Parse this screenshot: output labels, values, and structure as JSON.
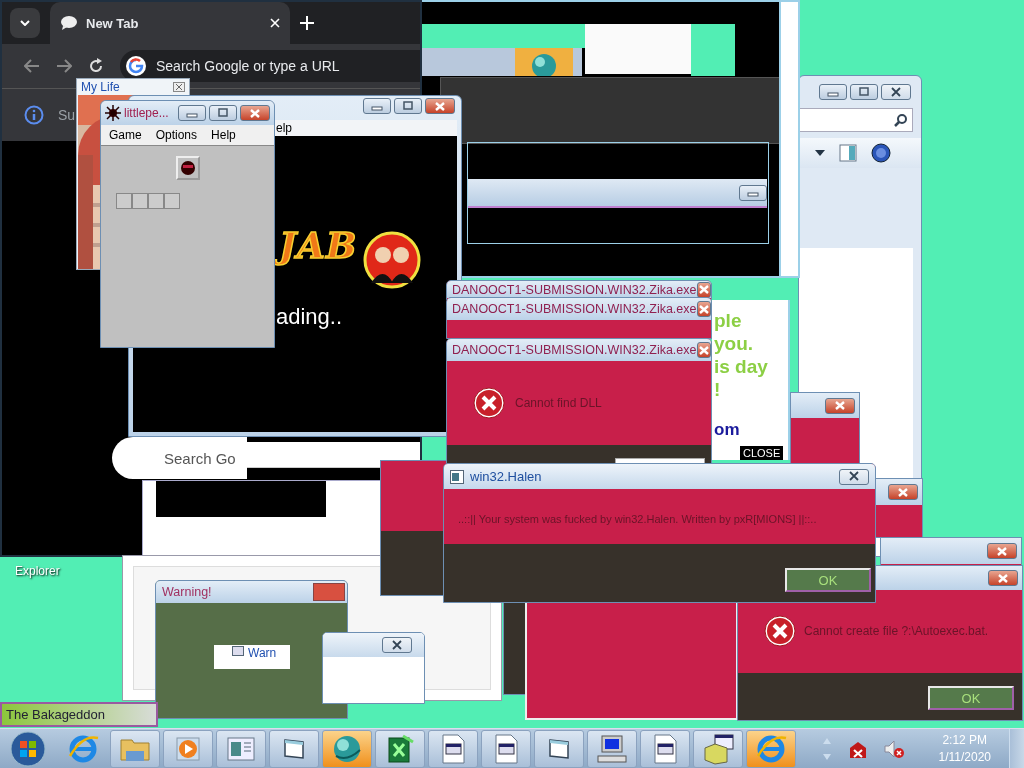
{
  "chrome_window": {
    "tab_title": "New Tab",
    "address_placeholder": "Search Google or type a URL",
    "info_text": "Su",
    "search_placeholder": "Search Go"
  },
  "my_life_window": {
    "title": "My Life"
  },
  "game_window": {
    "menu_fragment": "elp",
    "logo_text": "JAB",
    "loading_text": "ading.."
  },
  "littlepe_window": {
    "title": "littlepe...",
    "menu": [
      "Game",
      "Options",
      "Help"
    ]
  },
  "ad_popup": {
    "lines": [
      "ple",
      "you.",
      "is day",
      "!"
    ],
    "link": "om",
    "close_label": "CLOSE"
  },
  "zika_windows": [
    {
      "title": "DANOOCT1-SUBMISSION.WIN32.Zika.exe"
    },
    {
      "title": "DANOOCT1-SUBMISSION.WIN32.Zika.exe"
    },
    {
      "title": "DANOOCT1-SUBMISSION.WIN32.Zika.exe",
      "message": "Cannot find DLL"
    }
  ],
  "halen_dialog": {
    "title": "win32.Halen",
    "message": "..::|| Your system was fucked by win32.Halen. Written by pxR[MIONS] ||::..",
    "button": "OK"
  },
  "autoexec_dialog": {
    "message": "Cannot create file ?:\\Autoexec.bat.",
    "button": "OK"
  },
  "warning_window": {
    "title": "Warning!",
    "inner_title": "Warn"
  },
  "desktop_icon": {
    "label": "Explorer"
  },
  "bakageddon_bar": {
    "text": "The Bakageddon"
  },
  "taskbar": {
    "items": [
      {
        "kind": "browser",
        "selected": false
      },
      {
        "kind": "folder",
        "selected": false
      },
      {
        "kind": "media",
        "selected": false
      },
      {
        "kind": "panel",
        "selected": false
      },
      {
        "kind": "window",
        "selected": false
      },
      {
        "kind": "globe",
        "selected": true
      },
      {
        "kind": "sheet",
        "selected": false
      },
      {
        "kind": "document",
        "selected": false
      },
      {
        "kind": "document",
        "selected": false
      },
      {
        "kind": "window",
        "selected": false
      },
      {
        "kind": "computer",
        "selected": false
      },
      {
        "kind": "document",
        "selected": false
      },
      {
        "kind": "package",
        "selected": false
      },
      {
        "kind": "browser",
        "selected": true
      }
    ],
    "time": "2:12 PM",
    "date": "1/11/2020"
  }
}
